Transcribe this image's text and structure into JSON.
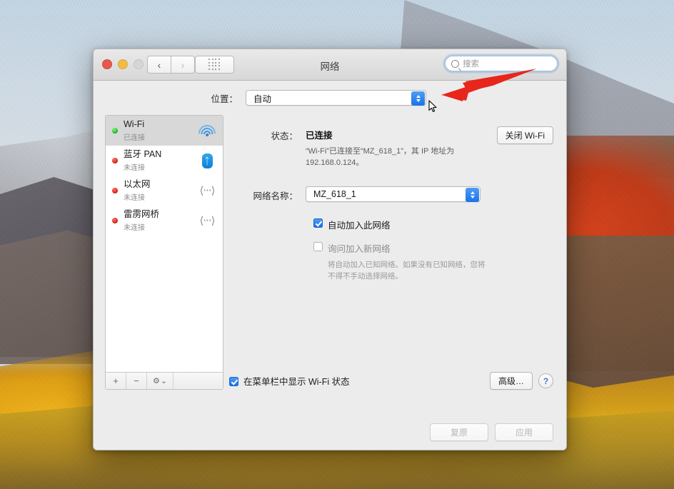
{
  "window": {
    "title": "网络",
    "traffic_lights": [
      "close",
      "minimize",
      "zoom"
    ],
    "nav": {
      "back_icon": "‹",
      "forward_icon": "›",
      "grid_icon": "grid-icon"
    },
    "search": {
      "placeholder": "搜索",
      "value": "",
      "icon": "search-icon"
    }
  },
  "location": {
    "label": "位置：",
    "value": "自动"
  },
  "sidebar": {
    "interfaces": [
      {
        "name": "Wi-Fi",
        "state": "已连接",
        "status_color": "green",
        "icon": "wifi-icon",
        "selected": true
      },
      {
        "name": "蓝牙 PAN",
        "state": "未连接",
        "status_color": "red",
        "icon": "bluetooth-icon",
        "selected": false
      },
      {
        "name": "以太网",
        "state": "未连接",
        "status_color": "red",
        "icon": "ethernet-icon",
        "selected": false
      },
      {
        "name": "雷雳网桥",
        "state": "未连接",
        "status_color": "red",
        "icon": "ethernet-icon",
        "selected": false
      }
    ],
    "toolbar": {
      "add": "+",
      "remove": "−",
      "gear": "⚙",
      "gear_chevron": "⌄"
    }
  },
  "main": {
    "status_label": "状态：",
    "status_value": "已连接",
    "status_description": "“Wi-Fi”已连接至“MZ_618_1”，其 IP 地址为 192.168.0.124。",
    "wifi_toggle_label": "关闭 Wi-Fi",
    "network_name_label": "网络名称：",
    "network_name_value": "MZ_618_1",
    "auto_join_label": "自动加入此网络",
    "auto_join_checked": true,
    "ask_join_label": "询问加入新网络",
    "ask_join_checked": false,
    "ask_join_hint": "将自动加入已知网络。如果没有已知网络，您将不得不手动选择网络。",
    "menubar_label": "在菜单栏中显示 Wi-Fi 状态",
    "menubar_checked": true,
    "advanced_label": "高级…",
    "help_label": "?"
  },
  "footer": {
    "revert_label": "复原",
    "apply_label": "应用"
  },
  "annotation": {
    "arrow_color": "#e8261c",
    "cursor": "pointer-arrow"
  }
}
